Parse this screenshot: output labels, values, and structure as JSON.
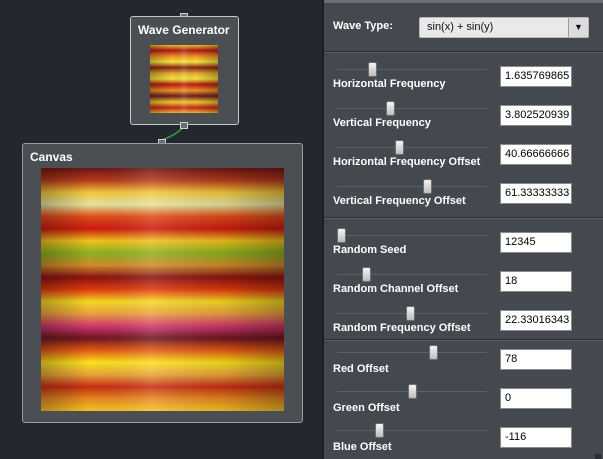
{
  "graph": {
    "wave_node": {
      "title": "Wave Generator"
    },
    "canvas_node": {
      "title": "Canvas"
    }
  },
  "panel": {
    "wave_type": {
      "label": "Wave Type:",
      "value": "sin(x) + sin(y)",
      "arrow": "▼"
    },
    "frequency": [
      {
        "label": "Horizontal Frequency",
        "value": "1.635769865",
        "fraction": 0.22
      },
      {
        "label": "Vertical Frequency",
        "value": "3.802520939",
        "fraction": 0.35
      },
      {
        "label": "Horizontal Frequency Offset",
        "value": "40.66666666",
        "fraction": 0.41
      },
      {
        "label": "Vertical Frequency Offset",
        "value": "61.33333333",
        "fraction": 0.61
      }
    ],
    "random": [
      {
        "label": "Random Seed",
        "value": "12345",
        "fraction": 0.0
      },
      {
        "label": "Random Channel Offset",
        "value": "18",
        "fraction": 0.18
      },
      {
        "label": "Random Frequency Offset",
        "value": "22.33016343",
        "fraction": 0.49
      }
    ],
    "color": [
      {
        "label": "Red Offset",
        "value": "78",
        "fraction": 0.65
      },
      {
        "label": "Green Offset",
        "value": "0",
        "fraction": 0.5
      },
      {
        "label": "Blue Offset",
        "value": "-116",
        "fraction": 0.27
      }
    ]
  },
  "colors": {
    "panel_bg": "#44494f",
    "graph_bg": "#23282f",
    "node_bg": "#4b4f54"
  }
}
